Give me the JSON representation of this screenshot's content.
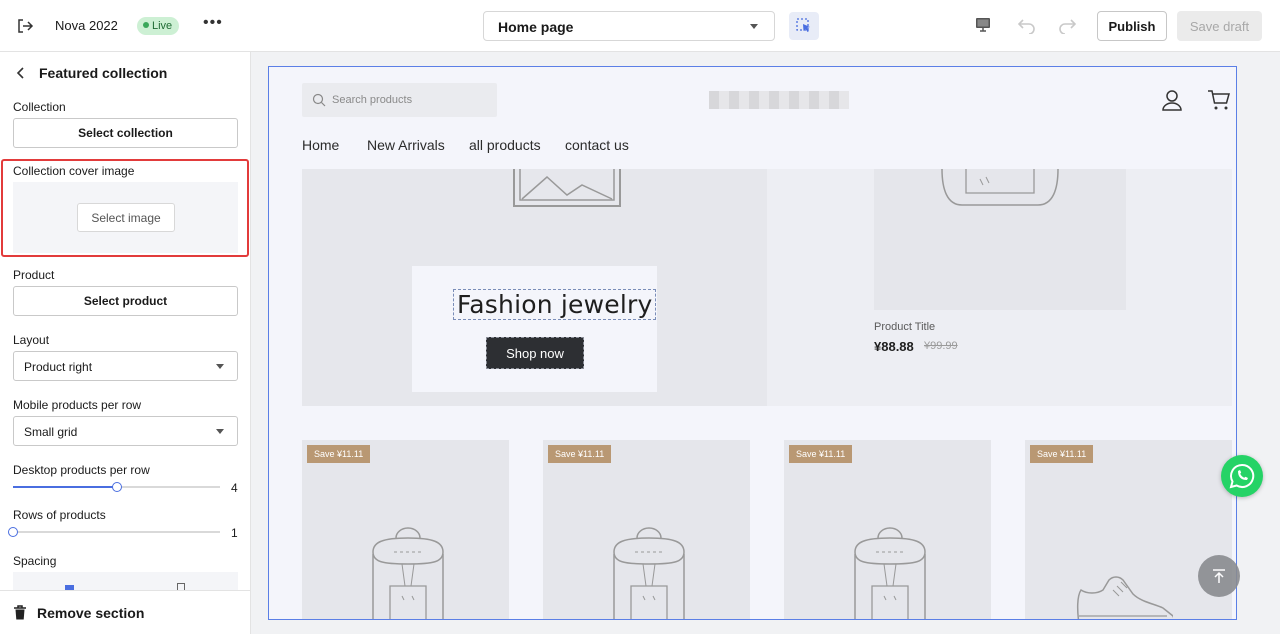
{
  "topbar": {
    "exit_icon": "exit-icon",
    "store_name": "Nova 2022",
    "status": "Live",
    "more": "•••",
    "page_select": "Home page",
    "publish": "Publish",
    "save_draft": "Save draft"
  },
  "sidebar": {
    "title": "Featured collection",
    "collection_label": "Collection",
    "select_collection": "Select collection",
    "cover_label": "Collection cover image",
    "select_image": "Select image",
    "product_label": "Product",
    "select_product": "Select product",
    "layout_label": "Layout",
    "layout_value": "Product right",
    "mobile_label": "Mobile products per row",
    "mobile_value": "Small grid",
    "desktop_label": "Desktop products per row",
    "desktop_value": "4",
    "rows_label": "Rows of products",
    "rows_value": "1",
    "spacing_label": "Spacing",
    "remove": "Remove section"
  },
  "preview": {
    "search_placeholder": "Search products",
    "nav": [
      "Home",
      "New Arrivals",
      "all products",
      "contact us"
    ],
    "hero_title": "Fashion jewelry",
    "shop_now": "Shop now",
    "product_title": "Product Title",
    "price": "¥88.88",
    "old_price": "¥99.99",
    "badges": [
      "Save ¥11.11",
      "Save ¥11.11",
      "Save ¥11.11",
      "Save ¥11.11"
    ]
  },
  "colors": {
    "accent": "#4a6ee0",
    "highlight": "#e23b3b",
    "badge": "#b99873",
    "whatsapp": "#25d366"
  }
}
